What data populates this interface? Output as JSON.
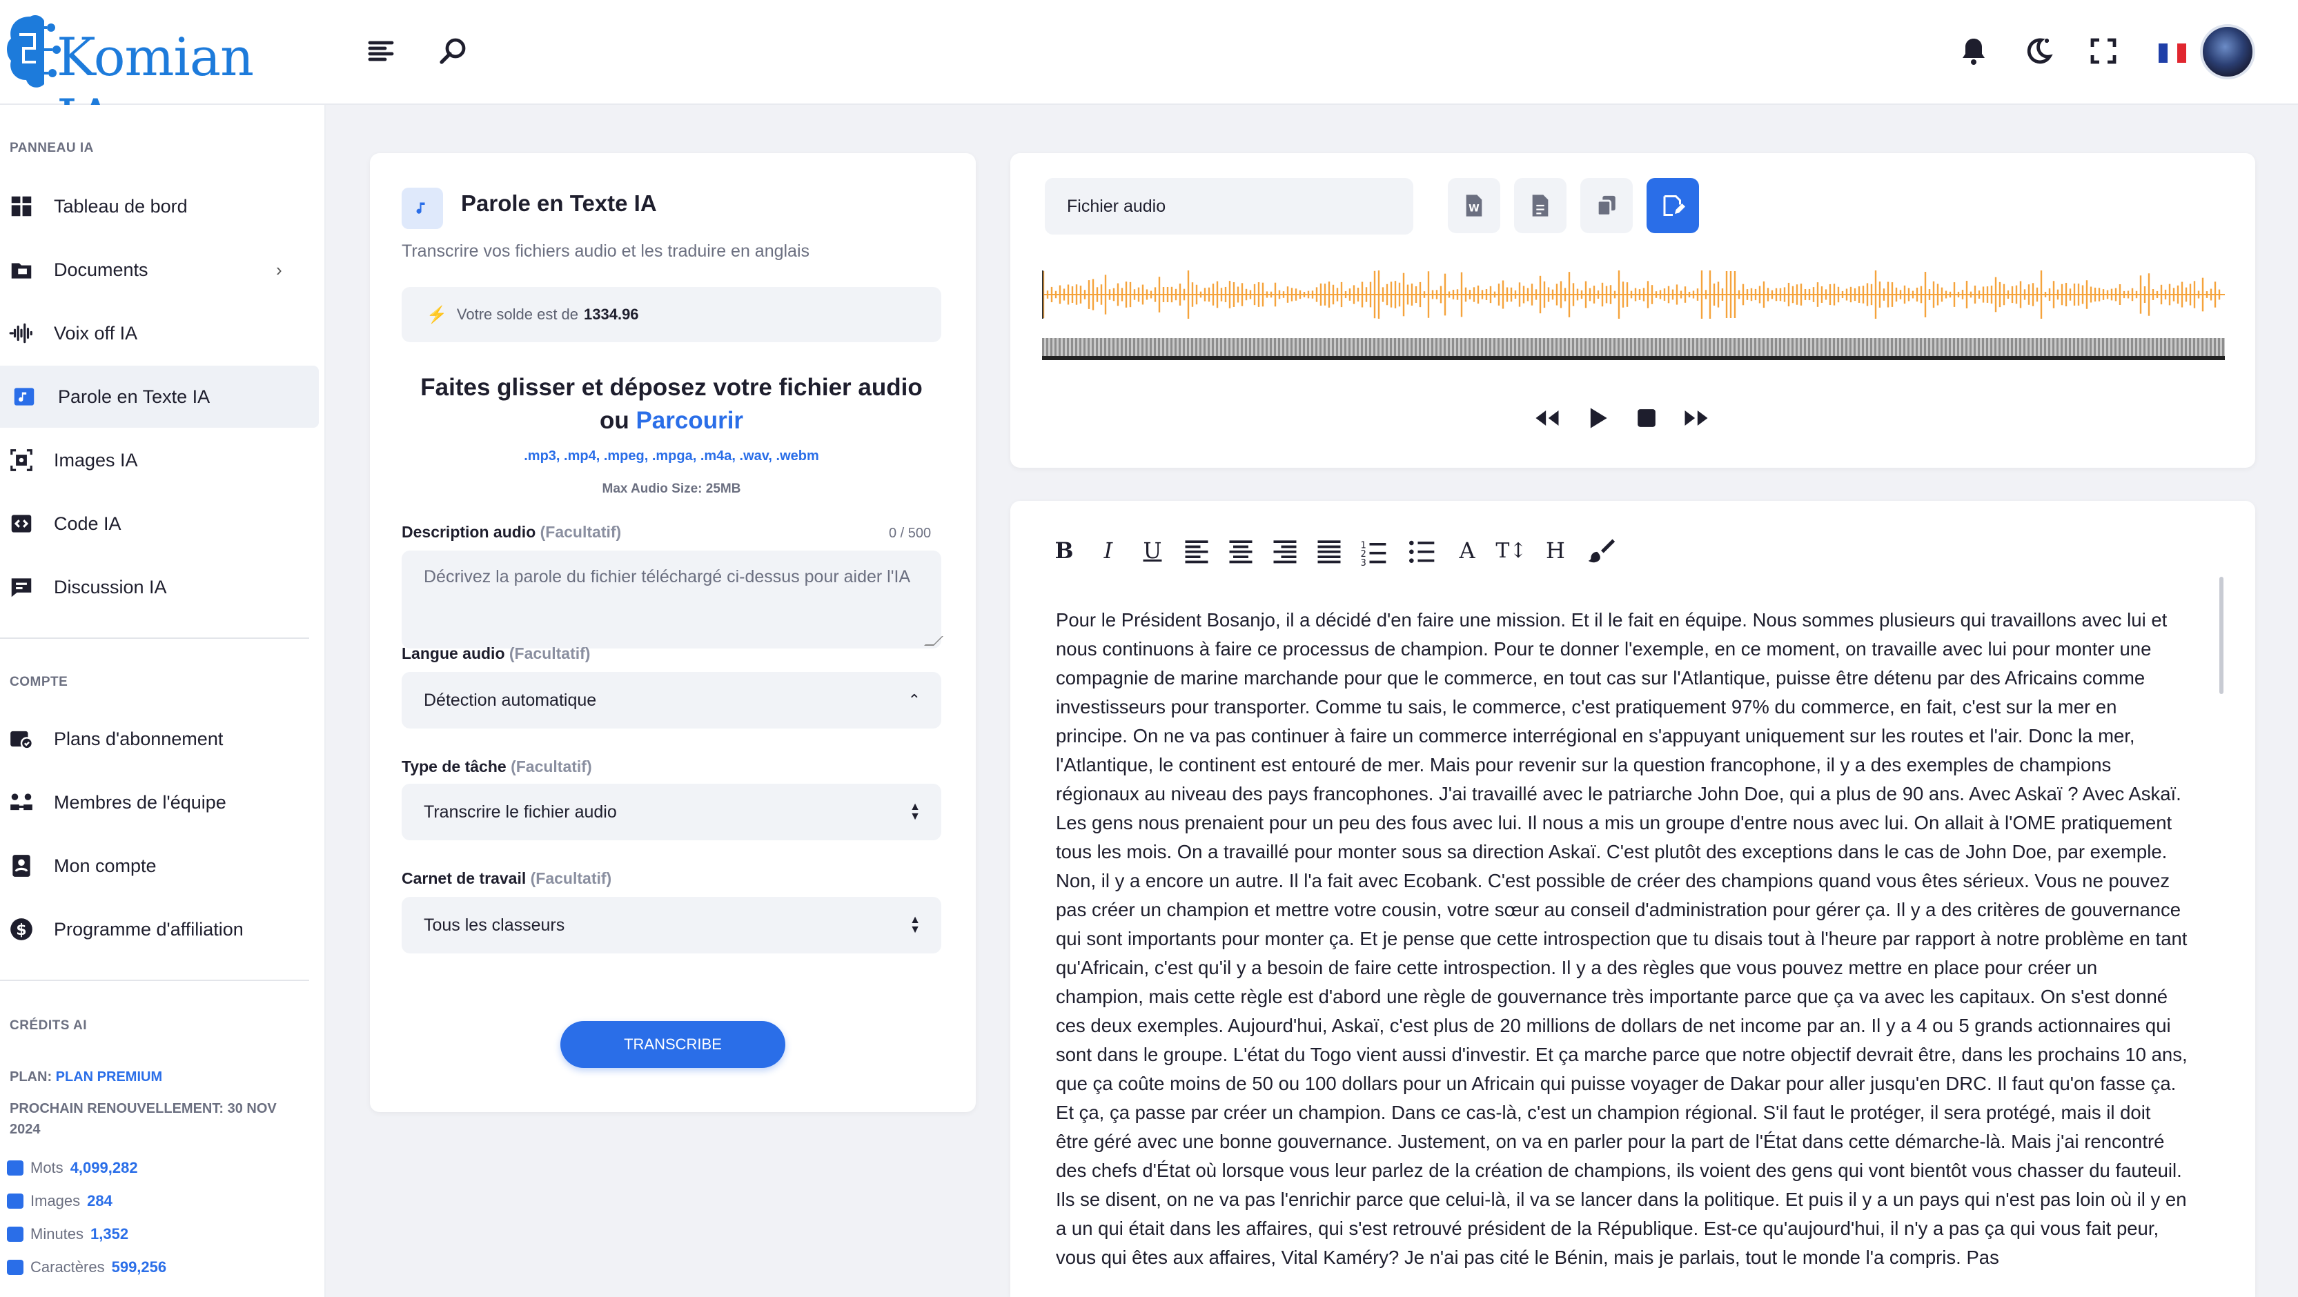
{
  "app": {
    "brand": "Komian IA",
    "brand_color": "#2a6ee8",
    "language_flag": "fr"
  },
  "header": {
    "icons": [
      "menu-icon",
      "search-icon",
      "bell-icon",
      "moon-icon",
      "fullscreen-icon"
    ]
  },
  "sidebar": {
    "panel_title": "PANNEAU IA",
    "items": [
      {
        "label": "Tableau de bord",
        "icon": "dashboard-icon"
      },
      {
        "label": "Documents",
        "icon": "folder-icon"
      },
      {
        "label": "Voix off IA",
        "icon": "waveform-icon"
      },
      {
        "label": "Parole en Texte IA",
        "icon": "audio-file-icon"
      },
      {
        "label": "Images IA",
        "icon": "image-icon"
      },
      {
        "label": "Code IA",
        "icon": "code-icon"
      },
      {
        "label": "Discussion IA",
        "icon": "chat-icon"
      }
    ],
    "account_title": "COMPTE",
    "account_items": [
      {
        "label": "Plans d'abonnement",
        "icon": "subscription-icon"
      },
      {
        "label": "Membres de l'équipe",
        "icon": "team-icon"
      },
      {
        "label": "Mon compte",
        "icon": "account-icon"
      },
      {
        "label": "Programme d'affiliation",
        "icon": "affiliate-icon"
      }
    ],
    "credits_title": "CRÉDITS AI",
    "plan_label": "PLAN:",
    "plan_value": "PLAN PREMIUM",
    "renewal_line1": "PROCHAIN RENOUVELLEMENT: 30 NOV",
    "renewal_line2": "2024",
    "stats": [
      {
        "label": "Mots",
        "value": "4,099,282"
      },
      {
        "label": "Images",
        "value": "284"
      },
      {
        "label": "Minutes",
        "value": "1,352"
      },
      {
        "label": "Caractères",
        "value": "599,256"
      }
    ]
  },
  "form": {
    "title": "Parole en Texte IA",
    "subtitle": "Transcrire vos fichiers audio et les traduire en anglais",
    "balance_label": "Votre solde est de",
    "balance_value": "1334.96",
    "drop_line1": "Faites glisser et déposez votre fichier audio",
    "drop_or": "ou",
    "drop_browse": "Parcourir",
    "formats": ".mp3, .mp4, .mpeg, .mpga, .m4a, .wav, .webm",
    "max_size": "Max Audio Size: 25MB",
    "description_label": "Description audio",
    "optional": "(Facultatif)",
    "description_counter": "0 / 500",
    "description_placeholder": "Décrivez la parole du fichier téléchargé ci-dessus pour aider l'IA",
    "language_label": "Langue audio",
    "language_value": "Détection automatique",
    "task_label": "Type de tâche",
    "task_value": "Transcrire le fichier audio",
    "workbook_label": "Carnet de travail",
    "workbook_value": "Tous les classeurs",
    "submit": "TRANSCRIBE"
  },
  "player": {
    "file_label": "Fichier audio",
    "wave_color": "#f5a33b",
    "tools": [
      "word-export-icon",
      "file-export-icon",
      "copy-icon",
      "edit-icon"
    ],
    "controls": [
      "rewind-icon",
      "play-icon",
      "stop-icon",
      "fast-forward-icon"
    ]
  },
  "editor": {
    "toolbar": [
      "bold-icon",
      "italic-icon",
      "underline-icon",
      "align-left-icon",
      "align-center-icon",
      "align-right-icon",
      "justify-icon",
      "ordered-list-icon",
      "bullet-list-icon",
      "font-color-icon",
      "font-size-icon",
      "heading-icon",
      "brush-icon"
    ],
    "text": "Pour le Président Bosanjo, il a décidé d'en faire une mission. Et il le fait en équipe. Nous sommes plusieurs qui travaillons avec lui et nous continuons à faire ce processus de champion. Pour te donner l'exemple, en ce moment, on travaille avec lui pour monter une compagnie de marine marchande pour que le commerce, en tout cas sur l'Atlantique, puisse être détenu par des Africains comme investisseurs pour transporter. Comme tu sais, le commerce, c'est pratiquement 97% du commerce, en fait, c'est sur la mer en principe. On ne va pas continuer à faire un commerce interrégional en s'appuyant uniquement sur les routes et l'air. Donc la mer, l'Atlantique, le continent est entouré de mer. Mais pour revenir sur la question francophone, il y a des exemples de champions régionaux au niveau des pays francophones. J'ai travaillé avec le patriarche John Doe, qui a plus de 90 ans. Avec Askaï ? Avec Askaï. Les gens nous prenaient pour un peu des fous avec lui. Il nous a mis un groupe d'entre nous avec lui. On allait à l'OME pratiquement tous les mois. On a travaillé pour monter sous sa direction Askaï. C'est plutôt des exceptions dans le cas de John Doe, par exemple. Non, il y a encore un autre. Il l'a fait avec Ecobank. C'est possible de créer des champions quand vous êtes sérieux. Vous ne pouvez pas créer un champion et mettre votre cousin, votre sœur au conseil d'administration pour gérer ça. Il y a des critères de gouvernance qui sont importants pour monter ça. Et je pense que cette introspection que tu disais tout à l'heure par rapport à notre problème en tant qu'Africain, c'est qu'il y a besoin de faire cette introspection. Il y a des règles que vous pouvez mettre en place pour créer un champion, mais cette règle est d'abord une règle de gouvernance très importante parce que ça va avec les capitaux. On s'est donné ces deux exemples. Aujourd'hui, Askaï, c'est plus de 20 millions de dollars de net income par an. Il y a 4 ou 5 grands actionnaires qui sont dans le groupe. L'état du Togo vient aussi d'investir. Et ça marche parce que notre objectif devrait être, dans les prochains 10 ans, que ça coûte moins de 50 ou 100 dollars pour un Africain qui puisse voyager de Dakar pour aller jusqu'en DRC. Il faut qu'on fasse ça. Et ça, ça passe par créer un champion. Dans ce cas-là, c'est un champion régional. S'il faut le protéger, il sera protégé, mais il doit être géré avec une bonne gouvernance. Justement, on va en parler pour la part de l'État dans cette démarche-là. Mais j'ai rencontré des chefs d'État où lorsque vous leur parlez de la création de champions, ils voient des gens qui vont bientôt vous chasser du fauteuil. Ils se disent, on ne va pas l'enrichir parce que celui-là, il va se lancer dans la politique. Et puis il y a un pays qui n'est pas loin où il y en a un qui était dans les affaires, qui s'est retrouvé président de la République. Est-ce qu'aujourd'hui, il n'y a pas ça qui vous fait peur, vous qui êtes aux affaires, Vital Kaméry? Je n'ai pas cité le Bénin, mais je parlais, tout le monde l'a compris. Pas"
  }
}
